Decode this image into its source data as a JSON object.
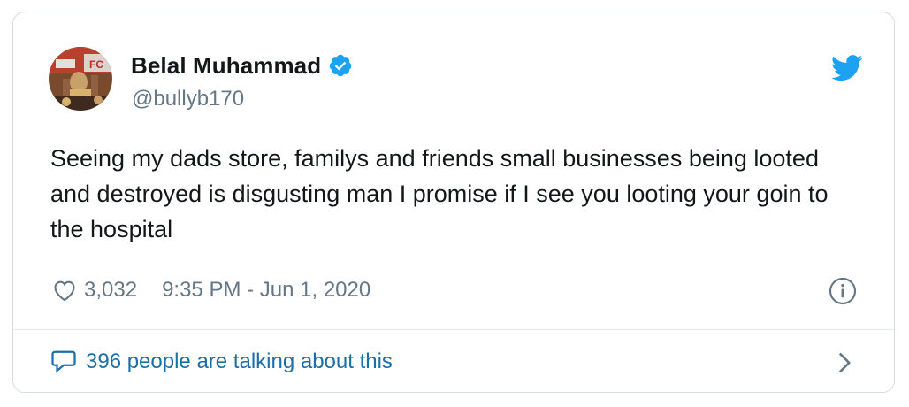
{
  "author": {
    "name": "Belal Muhammad",
    "handle": "@bullyb170",
    "verified": true
  },
  "tweet": {
    "text": "Seeing my dads store, familys and friends small businesses being looted and destroyed is disgusting man I promise if I see you looting your goin to the hospital"
  },
  "meta": {
    "likes": "3,032",
    "timestamp": "9:35 PM - Jun 1, 2020"
  },
  "footer": {
    "talking_label": "396 people are talking about this"
  },
  "icons": {
    "brand": "twitter-bird-icon",
    "verified": "verified-badge-icon",
    "like": "heart-icon",
    "info": "info-icon",
    "reply": "speech-bubble-icon",
    "more": "chevron-right-icon"
  },
  "colors": {
    "brand_blue": "#1da1f2",
    "text": "#14171a",
    "secondary": "#657786",
    "link": "#1b6fa8"
  }
}
